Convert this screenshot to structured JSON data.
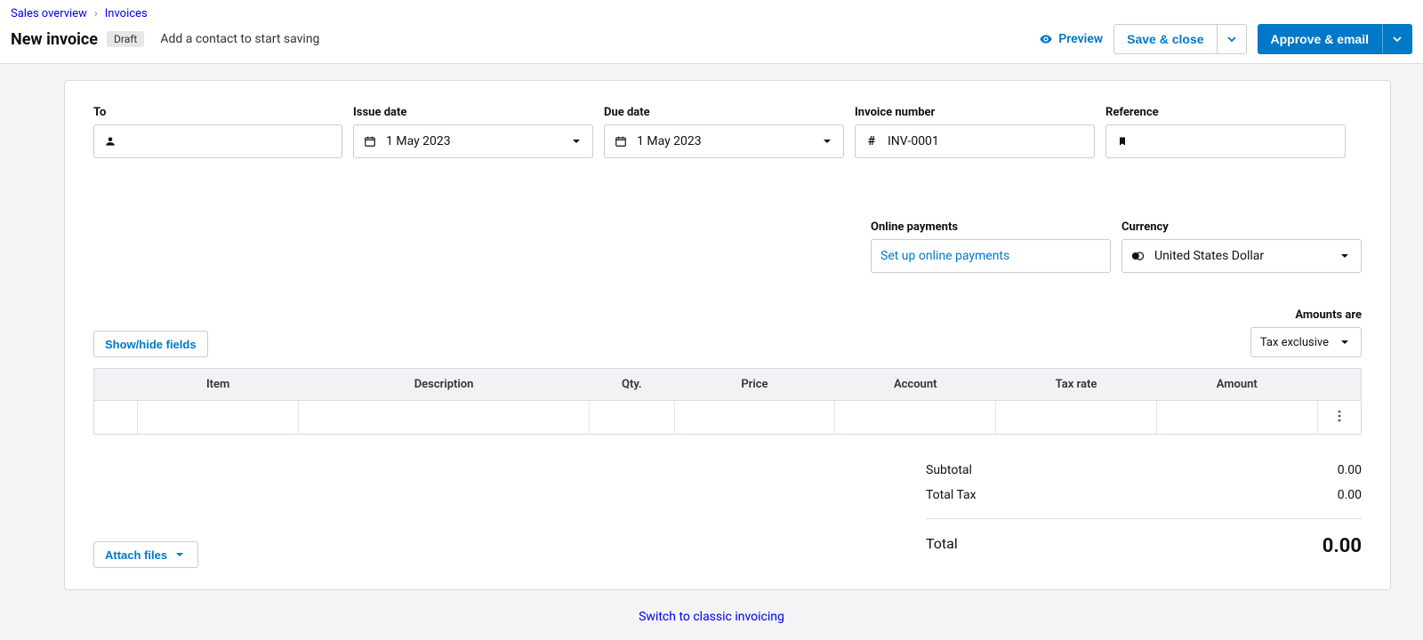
{
  "breadcrumb": {
    "root": "Sales overview",
    "current": "Invoices"
  },
  "header": {
    "title": "New invoice",
    "status_badge": "Draft",
    "hint": "Add a contact to start saving",
    "preview": "Preview",
    "save_close": "Save & close",
    "approve_email": "Approve & email"
  },
  "form": {
    "to_label": "To",
    "to_value": "",
    "issue_label": "Issue date",
    "issue_value": "1 May 2023",
    "due_label": "Due date",
    "due_value": "1 May 2023",
    "invno_label": "Invoice number",
    "invno_value": "INV-0001",
    "ref_label": "Reference",
    "ref_value": "",
    "online_label": "Online payments",
    "online_link": "Set up online payments",
    "currency_label": "Currency",
    "currency_value": "United States Dollar"
  },
  "controls": {
    "show_hide": "Show/hide fields",
    "amounts_label": "Amounts are",
    "amounts_value": "Tax exclusive",
    "attach": "Attach files"
  },
  "table": {
    "headers": {
      "item": "Item",
      "desc": "Description",
      "qty": "Qty.",
      "price": "Price",
      "account": "Account",
      "tax": "Tax rate",
      "amount": "Amount"
    }
  },
  "totals": {
    "subtotal_label": "Subtotal",
    "subtotal_value": "0.00",
    "tax_label": "Total Tax",
    "tax_value": "0.00",
    "total_label": "Total",
    "total_value": "0.00"
  },
  "footer": {
    "classic_link": "Switch to classic invoicing"
  }
}
